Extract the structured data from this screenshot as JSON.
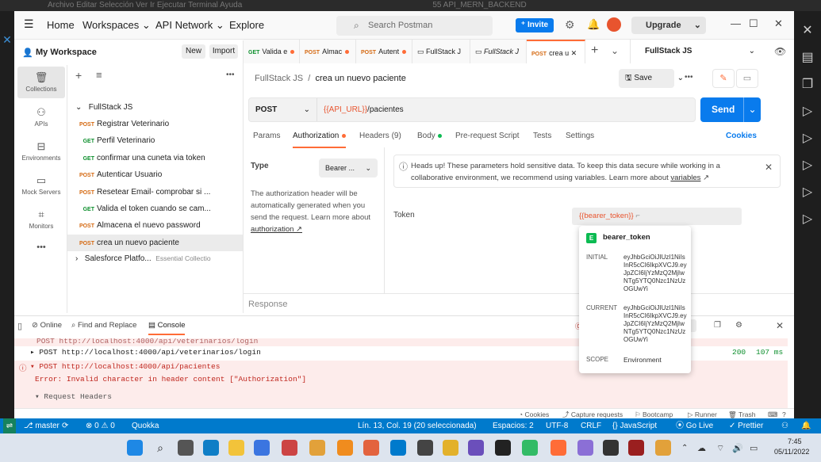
{
  "vscode": {
    "top_title": "Archivo   Editar   Selección   Ver   Ir   Ejecutar   Terminal   Ayuda",
    "window_title": "55 API_MERN_BACKEND",
    "status": {
      "branch": "master",
      "problems": "⊗ 0 ⚠ 0",
      "quokka": "Quokka",
      "position": "Lín. 13, Col. 19 (20 seleccionada)",
      "spaces": "Espacios: 2",
      "encoding": "UTF-8",
      "eol": "CRLF",
      "language": "{} JavaScript",
      "golive": "⦿ Go Live",
      "prettier": "✓ Prettier"
    }
  },
  "titlebar": {
    "home": "Home",
    "workspaces": "Workspaces",
    "api_network": "API Network",
    "explore": "Explore",
    "search_placeholder": "Search Postman",
    "invite": "Invite",
    "upgrade": "Upgrade"
  },
  "sidebar": {
    "workspace": "My Workspace",
    "new": "New",
    "import": "Import",
    "rail": [
      "Collections",
      "APIs",
      "Environments",
      "Mock Servers",
      "Monitors"
    ],
    "collection": "FullStack JS",
    "items": [
      {
        "method": "POST",
        "name": "Registrar Veterinario"
      },
      {
        "method": "GET",
        "name": "Perfil Veterinario"
      },
      {
        "method": "GET",
        "name": "confirmar una cuneta via token"
      },
      {
        "method": "POST",
        "name": "Autenticar Usuario"
      },
      {
        "method": "POST",
        "name": "Resetear Email- comprobar si ..."
      },
      {
        "method": "GET",
        "name": "Valida el token cuando se cam..."
      },
      {
        "method": "POST",
        "name": "Almacena el nuevo password"
      },
      {
        "method": "POST",
        "name": "crea un nuevo paciente"
      }
    ],
    "collection2": "Salesforce Platfo...",
    "collection2_badge": "Essential Collectio"
  },
  "tabs": [
    {
      "method": "GET",
      "label": "Valida e"
    },
    {
      "method": "POST",
      "label": "Almac"
    },
    {
      "method": "POST",
      "label": "Autent"
    },
    {
      "method": "",
      "label": "FullStack J"
    },
    {
      "method": "",
      "label": "FullStack J"
    },
    {
      "method": "POST",
      "label": "crea u"
    }
  ],
  "environment": "FullStack JS",
  "request": {
    "breadcrumb_parent": "FullStack JS",
    "breadcrumb_sep": "/",
    "name": "crea un nuevo paciente",
    "save": "Save",
    "method": "POST",
    "url_var": "{{API_URL}}",
    "url_path": "/pacientes",
    "send": "Send",
    "subtabs": {
      "params": "Params",
      "authorization": "Authorization",
      "headers": "Headers (9)",
      "body": "Body",
      "prerequest": "Pre-request Script",
      "tests": "Tests",
      "settings": "Settings",
      "cookies": "Cookies"
    }
  },
  "auth": {
    "type_label": "Type",
    "type_value": "Bearer ...",
    "description": "The authorization header will be automatically generated when you send the request. Learn more about",
    "link": "authorization ↗",
    "warning": "Heads up! These parameters hold sensitive data. To keep this data secure while working in a collaborative environment, we recommend using variables. Learn more about",
    "warning_link": "variables",
    "token_label": "Token",
    "token_value": "{{bearer_token}}"
  },
  "popover": {
    "badge": "E",
    "name": "bearer_token",
    "initial_label": "INITIAL",
    "initial_value": "eyJhbGciOiJIUzI1NiIsInR5cCI6IkpXVCJ9.eyJpZCI6IjYzMzQ2MjIwNTg5YTQ0Nzc1NzUzOGUwYi",
    "current_label": "CURRENT",
    "current_value": "eyJhbGciOiJIUzI1NiIsInR5cCI6IkpXVCJ9.eyJpZCI6IjYzMzQ2MjIwNTg5YTQ0Nzc1NzUzOGUwYi",
    "scope_label": "SCOPE",
    "scope_value": "Environment"
  },
  "response_label": "Response",
  "console": {
    "online": "Online",
    "find_replace": "Find and Replace",
    "console": "Console",
    "line1": "POST http://localhost:4000/api/veterinarios/login",
    "line2": "▸ POST http://localhost:4000/api/veterinarios/login",
    "line2_status": "200",
    "line2_time": "107 ms",
    "line3": "▾ POST http://localhost:4000/api/pacientes",
    "line4": "Error: Invalid character in header content [\"Authorization\"]",
    "line5": "▾ Request Headers",
    "bottom": [
      "Cookies",
      "Capture requests",
      "Bootcamp",
      "Runner",
      "Trash"
    ]
  },
  "clock": {
    "time": "7:45",
    "date": "05/11/2022"
  }
}
